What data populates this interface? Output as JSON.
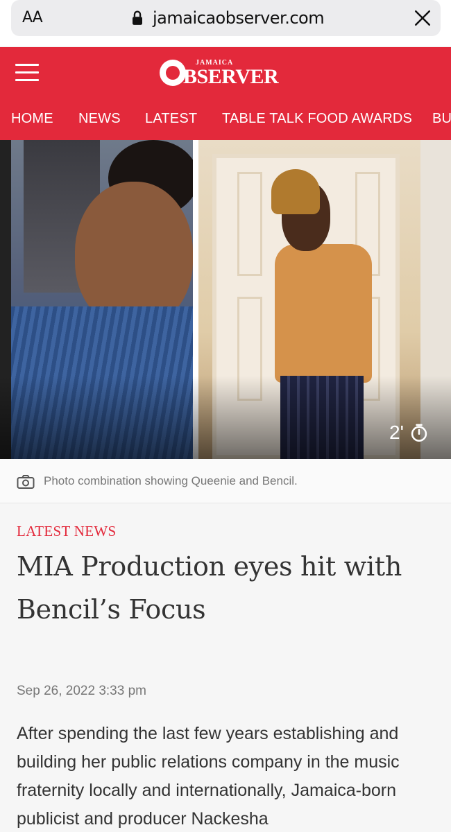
{
  "browser": {
    "text_size_label": "AA",
    "url": "jamaicaobserver.com"
  },
  "header": {
    "logo_small": "JAMAICA",
    "logo_main": "BSERVER",
    "nav_items": [
      "HOME",
      "NEWS",
      "LATEST",
      "TABLE TALK FOOD AWARDS",
      "BU"
    ]
  },
  "hero": {
    "read_time": "2'"
  },
  "caption": {
    "text": "Photo combination showing Queenie and Bencil."
  },
  "article": {
    "category": "LATEST NEWS",
    "headline_line1": "MIA Production eyes hit with",
    "headline_line2": "Bencil’s Focus",
    "date": "Sep 26, 2022 3:33 pm",
    "body": "After spending the last few years establishing and building her public relations company in the music fraternity locally and internationally, Jamaica-born publicist and producer Nackesha"
  },
  "colors": {
    "brand_red": "#e3293b",
    "caption_gray": "#777777"
  }
}
